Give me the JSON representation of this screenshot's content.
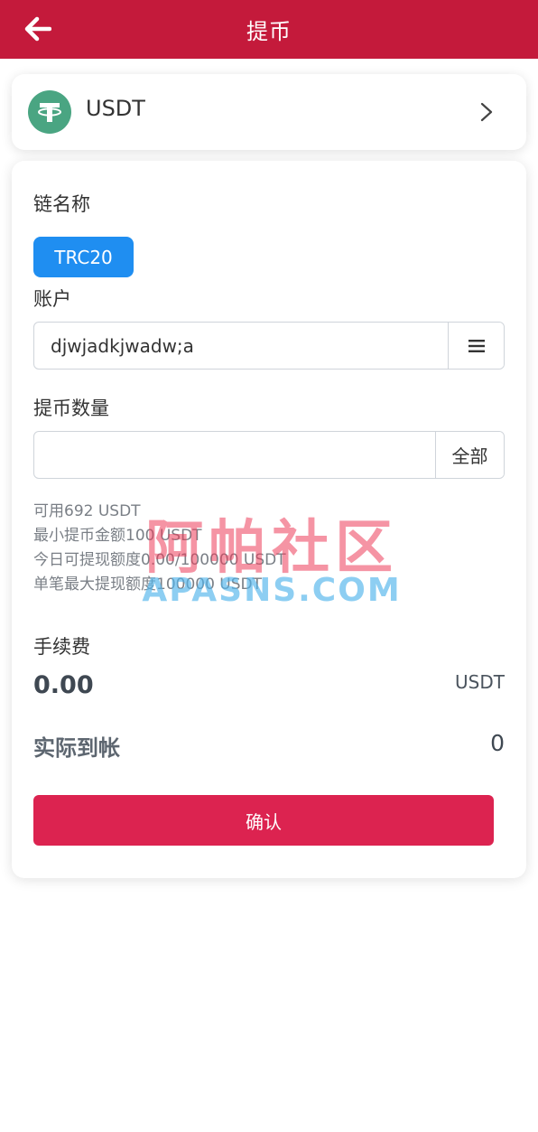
{
  "header": {
    "title": "提币",
    "back_icon": "arrow-left-icon",
    "color": "#c41a3b"
  },
  "coin": {
    "name": "USDT",
    "logo_icon": "tether-icon",
    "logo_color": "#4aa582",
    "chevron_icon": "chevron-right-icon"
  },
  "form": {
    "chain_label": "链名称",
    "chain_option": "TRC20",
    "chain_color": "#1f8ef1",
    "account_label": "账户",
    "account_value": "djwjadkjwadw;a",
    "account_menu_icon": "menu-icon",
    "amount_label": "提币数量",
    "amount_value": "",
    "amount_all_label": "全部",
    "info": {
      "available": "可用692 USDT",
      "min_amount": "最小提币金额100 USDT",
      "daily_limit": "今日可提现额度0.00/100000 USDT",
      "single_max": "单笔最大提现额度100000 USDT"
    },
    "fee_label": "手续费",
    "fee_value": "0.00",
    "fee_unit": "USDT",
    "actual_label": "实际到帐",
    "actual_value": "0",
    "confirm_label": "确认",
    "confirm_color": "#dc2350"
  },
  "watermark": {
    "line1": "阿帕社区",
    "line2": "APASNS.COM"
  }
}
